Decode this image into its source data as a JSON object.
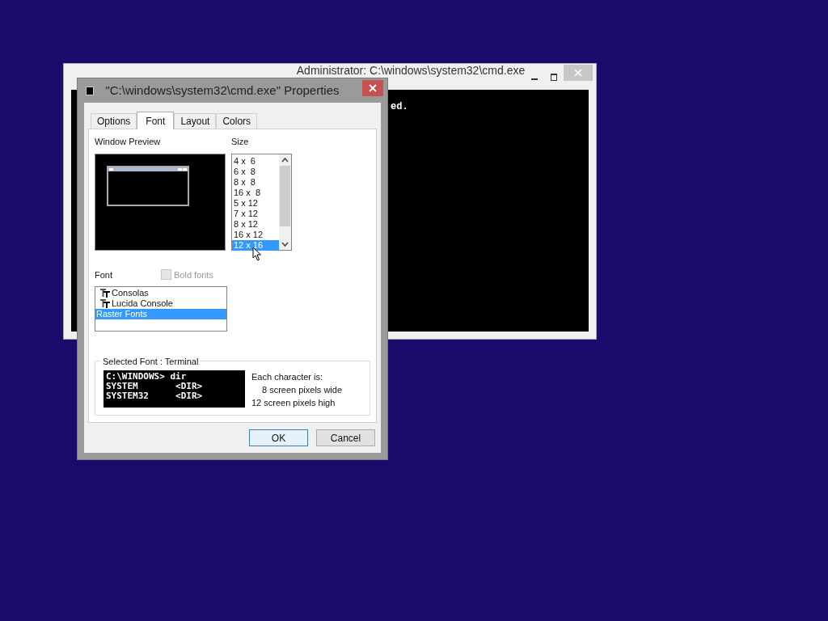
{
  "background_window": {
    "title": "Administrator: C:\\windows\\system32\\cmd.exe",
    "console_lines": [
      "ed."
    ]
  },
  "dialog": {
    "title": "\"C:\\windows\\system32\\cmd.exe\" Properties",
    "tabs": [
      {
        "label": "Options",
        "selected": false
      },
      {
        "label": "Font",
        "selected": true
      },
      {
        "label": "Layout",
        "selected": false
      },
      {
        "label": "Colors",
        "selected": false
      }
    ],
    "window_preview": {
      "label": "Window Preview"
    },
    "size": {
      "label": "Size",
      "items": [
        {
          "label": "4 x  6",
          "selected": false
        },
        {
          "label": "6 x  8",
          "selected": false
        },
        {
          "label": "8 x  8",
          "selected": false
        },
        {
          "label": "16 x  8",
          "selected": false
        },
        {
          "label": "5 x 12",
          "selected": false
        },
        {
          "label": "7 x 12",
          "selected": false
        },
        {
          "label": "8 x 12",
          "selected": false
        },
        {
          "label": "16 x 12",
          "selected": false
        },
        {
          "label": "12 x 16",
          "selected": true
        }
      ]
    },
    "font": {
      "label": "Font",
      "bold_fonts": {
        "label": "Bold fonts",
        "checked": false,
        "disabled": true
      },
      "items": [
        {
          "label": "Consolas",
          "kind": "truetype",
          "selected": false
        },
        {
          "label": "Lucida Console",
          "kind": "truetype",
          "selected": false
        },
        {
          "label": "Raster Fonts",
          "kind": "raster",
          "selected": true
        }
      ]
    },
    "selected_font": {
      "label": "Selected Font : Terminal",
      "sample_lines": [
        "C:\\WINDOWS> dir",
        "SYSTEM       <DIR>",
        "SYSTEM32     <DIR>"
      ],
      "heading": "Each character is:",
      "width": "8 screen pixels wide",
      "height": "12 screen pixels high"
    },
    "buttons": [
      {
        "label": "OK",
        "default": true
      },
      {
        "label": "Cancel",
        "default": false
      }
    ]
  }
}
